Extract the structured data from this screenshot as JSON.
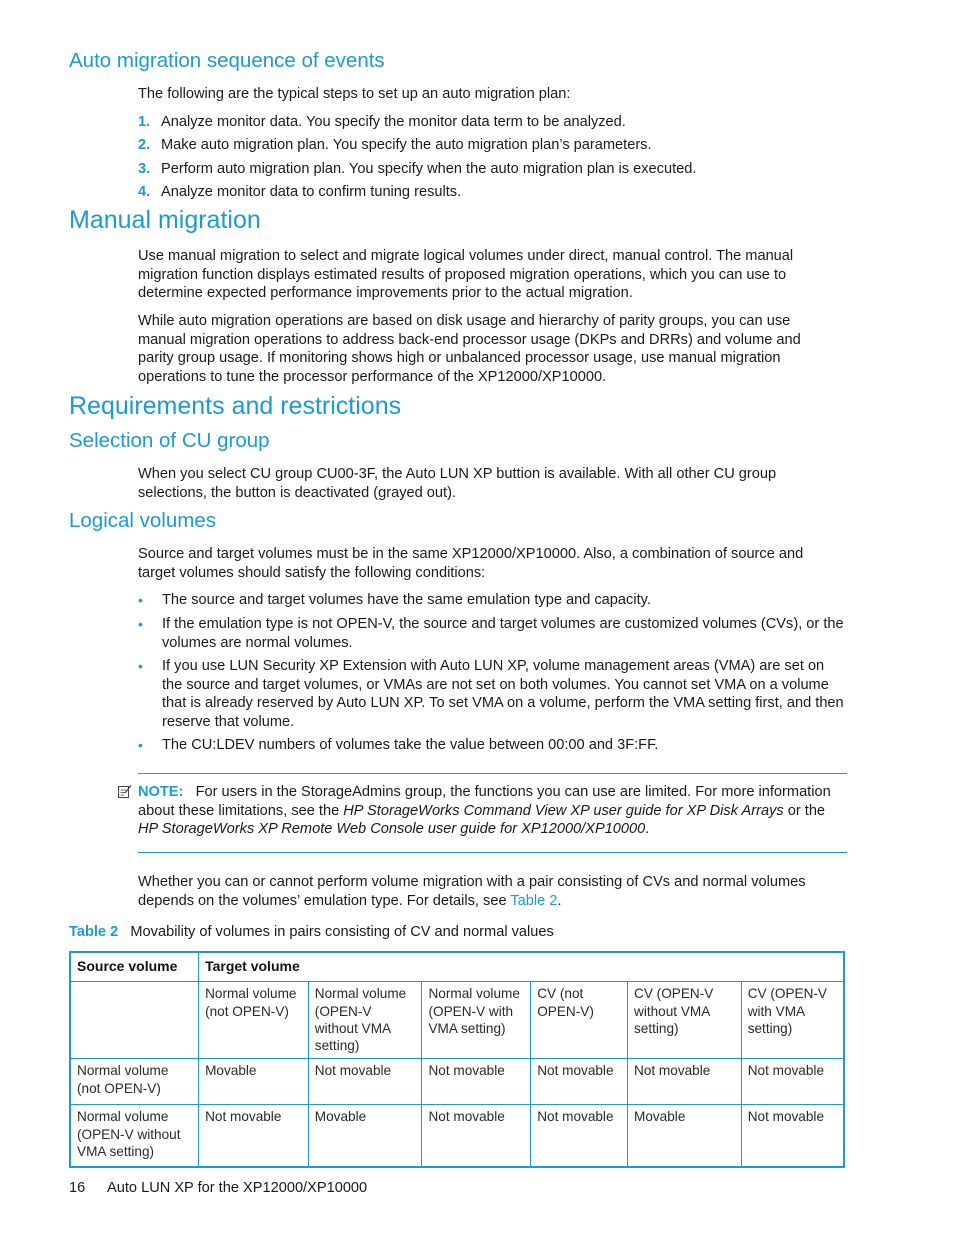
{
  "sections": {
    "auto_sequence": {
      "heading": "Auto migration sequence of events",
      "intro": "The following are the typical steps to set up an auto migration plan:",
      "steps": [
        {
          "num": "1.",
          "text": "Analyze monitor data. You specify the monitor data term to be analyzed."
        },
        {
          "num": "2.",
          "text": "Make auto migration plan. You specify the auto migration plan’s parameters."
        },
        {
          "num": "3.",
          "text": "Perform auto migration plan. You specify when the auto migration plan is executed."
        },
        {
          "num": "4.",
          "text": "Analyze monitor data to confirm tuning results."
        }
      ]
    },
    "manual_migration": {
      "heading": "Manual migration",
      "para1": "Use manual migration to select and migrate logical volumes under direct, manual control. The manual migration function displays estimated results of proposed migration operations, which you can use to determine expected performance improvements prior to the actual migration.",
      "para2": "While auto migration operations are based on disk usage and hierarchy of parity groups, you can use manual migration operations to address back-end processor usage (DKPs and DRRs) and volume and parity group usage. If monitoring shows high or unbalanced processor usage, use manual migration operations to tune the processor performance of the XP12000/XP10000."
    },
    "requirements": {
      "heading": "Requirements and restrictions"
    },
    "cu_group": {
      "heading": "Selection of CU group",
      "para": "When you select CU group CU00-3F, the Auto LUN XP buttion is available. With all other CU group selections, the button is deactivated (grayed out)."
    },
    "logical_volumes": {
      "heading": "Logical volumes",
      "intro": "Source and target volumes must be in the same XP12000/XP10000. Also, a combination of source and target volumes should satisfy the following conditions:",
      "bullets": [
        "The source and target volumes have the same emulation type and capacity.",
        "If the emulation type is not OPEN-V, the source and target volumes are customized volumes (CVs), or the volumes are normal volumes.",
        "If you use LUN Security XP Extension with Auto LUN XP, volume management areas (VMA) are set on the source and target volumes, or VMAs are not set on both volumes. You cannot set VMA on a volume that is already reserved by Auto LUN XP. To set VMA on a volume, perform the VMA setting first, and then reserve that volume.",
        "The CU:LDEV numbers of volumes take the value between 00:00 and 3F:FF."
      ],
      "note": {
        "label": "NOTE:",
        "text_before": "For users in the StorageAdmins group, the functions you can use are limited. For more information about these limitations, see the",
        "italic1": "HP StorageWorks Command View XP user guide for XP Disk Arrays",
        "text_mid": "or the",
        "italic2": "HP StorageWorks XP Remote Web Console user guide for XP12000/XP10000",
        "text_end": "."
      },
      "after_note": "Whether you can or cannot perform volume migration with a pair consisting of CVs and normal volumes depends on the volumes’ emulation type. For details, see",
      "after_note_link": "Table 2",
      "after_note_end": "."
    }
  },
  "table2": {
    "caption_label": "Table 2",
    "caption_text": "Movability of volumes in pairs consisting of CV and normal values",
    "header_source": "Source volume",
    "header_target": "Target volume",
    "target_columns": [
      "Normal volume (not OPEN-V)",
      "Normal volume (OPEN-V without VMA setting)",
      "Normal volume (OPEN-V with VMA setting)",
      "CV (not OPEN-V)",
      "CV (OPEN-V without VMA setting)",
      "CV (OPEN-V with VMA setting)"
    ],
    "rows": [
      {
        "source": "Normal volume (not OPEN-V)",
        "cells": [
          "Movable",
          "Not movable",
          "Not movable",
          "Not movable",
          "Not movable",
          "Not movable"
        ]
      },
      {
        "source": "Normal volume (OPEN-V without VMA setting)",
        "cells": [
          "Not movable",
          "Movable",
          "Not movable",
          "Not movable",
          "Movable",
          "Not movable"
        ]
      }
    ]
  },
  "footer": {
    "page_number": "16",
    "title": "Auto LUN XP for the XP12000/XP10000"
  }
}
